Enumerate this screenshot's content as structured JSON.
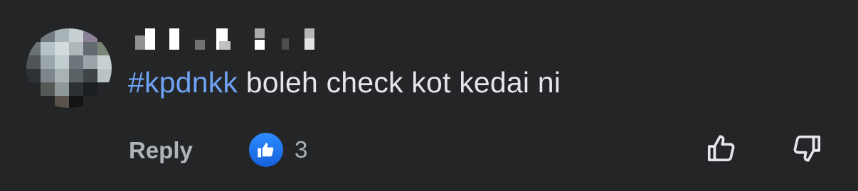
{
  "comment": {
    "author_name": "",
    "hashtag": "#kpdnkk",
    "text": " boleh check kot kedai ni"
  },
  "actions": {
    "reply_label": "Reply",
    "reaction_count": "3",
    "reaction_icon": "like-icon",
    "upvote_icon": "thumbs-up-outline-icon",
    "downvote_icon": "thumbs-down-outline-icon"
  },
  "colors": {
    "background": "#242526",
    "text": "#e4e6eb",
    "muted": "#b0b3b8",
    "hashtag": "#6ea3f4",
    "like_badge": "#1877f2"
  }
}
